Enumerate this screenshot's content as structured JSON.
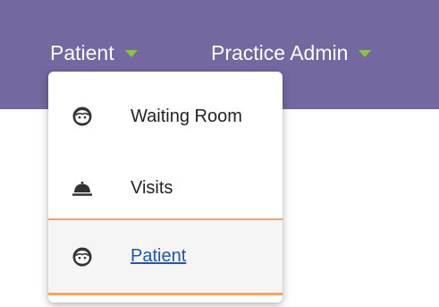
{
  "nav": {
    "patient_label": "Patient",
    "admin_label": "Practice Admin"
  },
  "dropdown": {
    "items": [
      {
        "label": "Waiting Room",
        "icon": "face-icon"
      },
      {
        "label": "Visits",
        "icon": "service-bell-icon"
      },
      {
        "label": "Patient",
        "icon": "face-icon",
        "active": true
      }
    ]
  },
  "colors": {
    "navbar": "#7567a0",
    "caret": "#8bc34a",
    "active_border": "#f5a462",
    "active_link": "#2255aa"
  }
}
